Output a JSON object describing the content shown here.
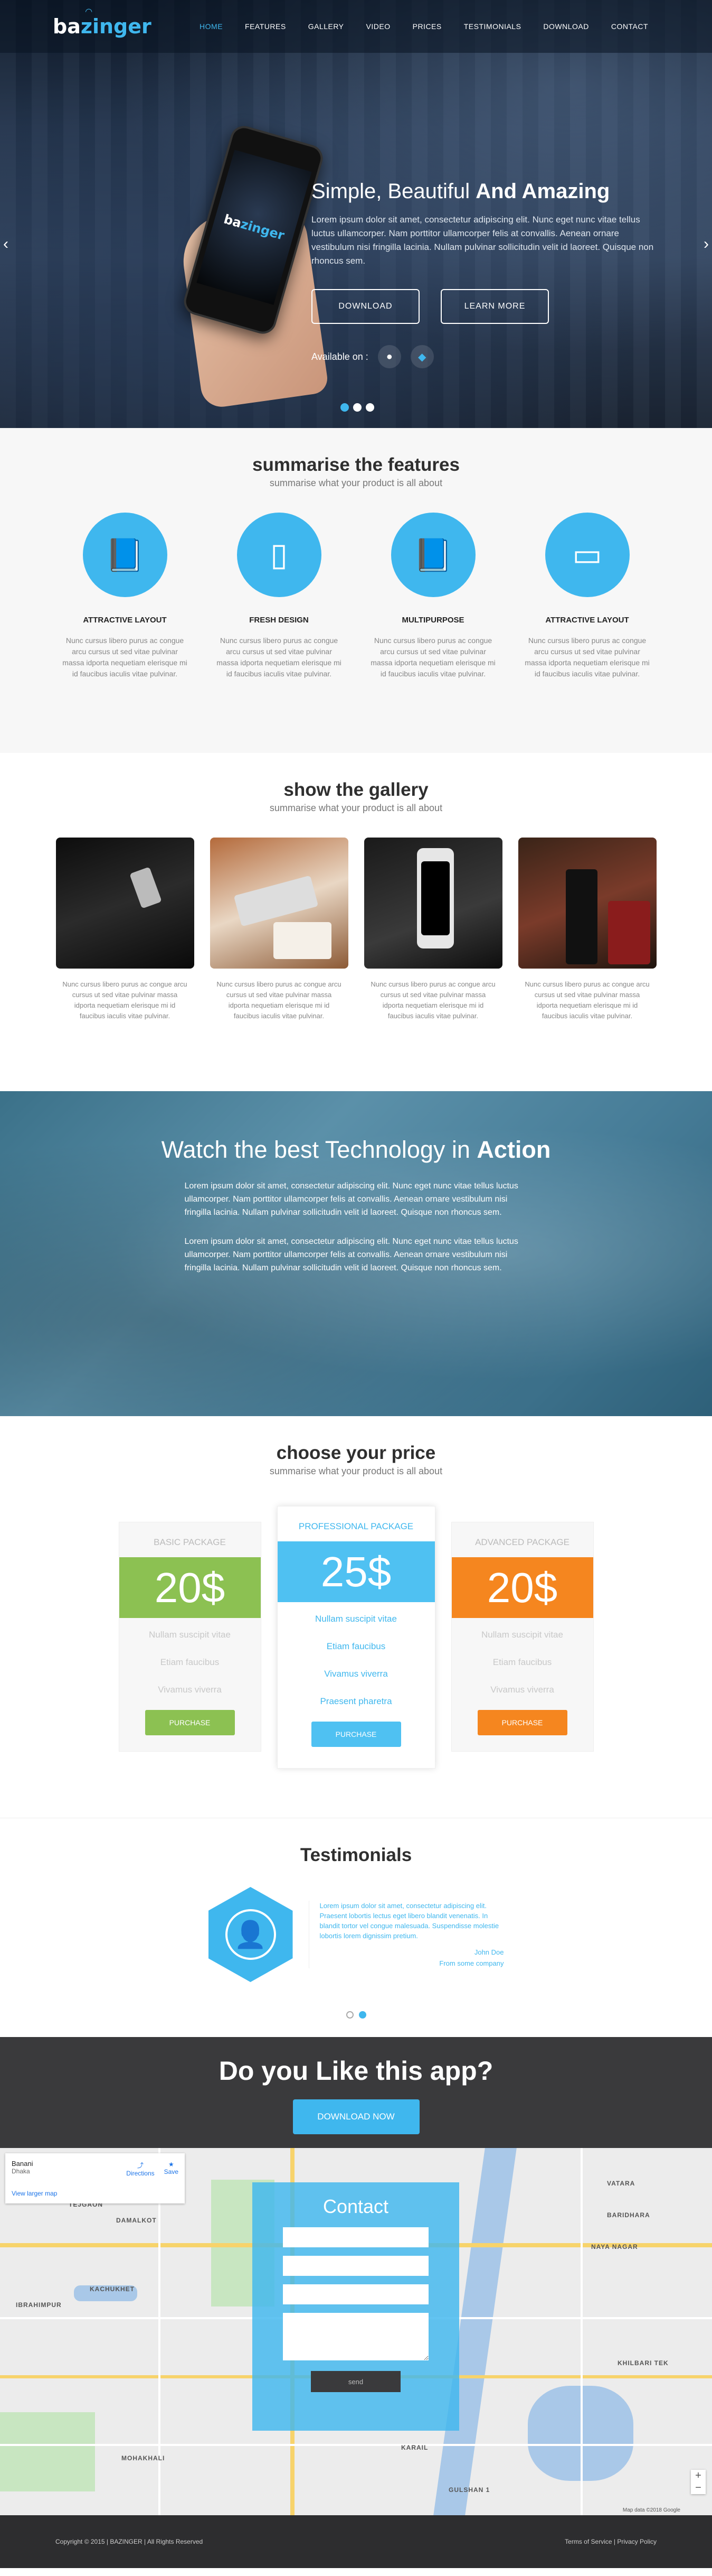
{
  "nav": {
    "logo_main": "ba",
    "logo_accent": "zinger",
    "items": [
      "HOME",
      "FEATURES",
      "GALLERY",
      "VIDEO",
      "PRICES",
      "TESTIMONIALS",
      "DOWNLOAD",
      "CONTACT"
    ]
  },
  "hero": {
    "title_light": "Simple, Beautiful ",
    "title_bold": "And Amazing",
    "description": "Lorem ipsum dolor sit amet, consectetur adipiscing elit. Nunc eget nunc vitae tellus luctus ullamcorper. Nam porttitor ullamcorper felis at convallis. Aenean ornare vestibulum nisi fringilla lacinia. Nullam pulvinar sollicitudin velit id laoreet. Quisque non rhoncus sem.",
    "btn_download": "DOWNLOAD",
    "btn_learn": "LEARN MORE",
    "available_on": "Available on :",
    "phone_logo_main": "ba",
    "phone_logo_accent": "zinger"
  },
  "features": {
    "title": "summarise the features",
    "subtitle": "summarise what your product is all about",
    "items": [
      {
        "title": "ATTRACTIVE LAYOUT",
        "text": "Nunc cursus libero purus ac congue arcu cursus ut sed vitae pulvinar massa idporta nequetiam elerisque mi id faucibus iaculis vitae pulvinar.",
        "icon": "book-icon"
      },
      {
        "title": "FRESH DESIGN",
        "text": "Nunc cursus libero purus ac congue arcu cursus ut sed vitae pulvinar massa idporta nequetiam elerisque mi id faucibus iaculis vitae pulvinar.",
        "icon": "mobile-icon"
      },
      {
        "title": "MULTIPURPOSE",
        "text": "Nunc cursus libero purus ac congue arcu cursus ut sed vitae pulvinar massa idporta nequetiam elerisque mi id faucibus iaculis vitae pulvinar.",
        "icon": "book-icon"
      },
      {
        "title": "ATTRACTIVE LAYOUT",
        "text": "Nunc cursus libero purus ac congue arcu cursus ut sed vitae pulvinar massa idporta nequetiam elerisque mi id faucibus iaculis vitae pulvinar.",
        "icon": "desktop-icon"
      }
    ]
  },
  "gallery": {
    "title": "show the gallery",
    "subtitle": "summarise what your product is all about",
    "items": [
      {
        "text": "Nunc cursus libero purus ac congue arcu cursus ut sed vitae pulvinar massa idporta nequetiam elerisque mi id faucibus iaculis vitae pulvinar."
      },
      {
        "text": "Nunc cursus libero purus ac congue arcu cursus ut sed vitae pulvinar massa idporta nequetiam elerisque mi id faucibus iaculis vitae pulvinar."
      },
      {
        "text": "Nunc cursus libero purus ac congue arcu cursus ut sed vitae pulvinar massa idporta nequetiam elerisque mi id faucibus iaculis vitae pulvinar."
      },
      {
        "text": "Nunc cursus libero purus ac congue arcu cursus ut sed vitae pulvinar massa idporta nequetiam elerisque mi id faucibus iaculis vitae pulvinar."
      }
    ]
  },
  "action": {
    "title_light": "Watch the best Technology in ",
    "title_bold": "Action",
    "p1": "Lorem ipsum dolor sit amet, consectetur adipiscing elit. Nunc eget nunc vitae tellus luctus ullamcorper. Nam porttitor ullamcorper felis at convallis. Aenean ornare vestibulum nisi fringilla lacinia. Nullam pulvinar sollicitudin velit id laoreet. Quisque non rhoncus sem.",
    "p2": "Lorem ipsum dolor sit amet, consectetur adipiscing elit. Nunc eget nunc vitae tellus luctus ullamcorper. Nam porttitor ullamcorper felis at convallis. Aenean ornare vestibulum nisi fringilla lacinia. Nullam pulvinar sollicitudin velit id laoreet. Quisque non rhoncus sem."
  },
  "pricing": {
    "title": "choose your price",
    "subtitle": "summarise what your product is all about",
    "plans": [
      {
        "name": "BASIC PACKAGE",
        "price": "20$",
        "features": [
          "Nullam suscipit vitae",
          "Etiam faucibus",
          "Vivamus viverra"
        ],
        "button": "PURCHASE"
      },
      {
        "name": "PROFESSIONAL PACKAGE",
        "price": "25$",
        "features": [
          "Nullam suscipit vitae",
          "Etiam faucibus",
          "Vivamus viverra",
          "Praesent pharetra"
        ],
        "button": "PURCHASE"
      },
      {
        "name": "ADVANCED PACKAGE",
        "price": "20$",
        "features": [
          "Nullam suscipit vitae",
          "Etiam faucibus",
          "Vivamus viverra"
        ],
        "button": "PURCHASE"
      }
    ]
  },
  "testimonials": {
    "title": "Testimonials",
    "quote": "Lorem ipsum dolor sit amet, consectetur adipiscing elit. Praesent lobortis lectus eget libero blandit venenatis. In blandit tortor vel congue malesuada. Suspendisse molestie lobortis lorem dignissim pretium.",
    "author": "John Doe",
    "company": "From some company"
  },
  "cta": {
    "title": "Do you Like this app?",
    "button": "DOWNLOAD NOW"
  },
  "map": {
    "place": "Banani",
    "city": "Dhaka",
    "directions": "Directions",
    "save": "Save",
    "view_larger": "View larger map",
    "labels": [
      "TEJGAON",
      "DAMALKOT",
      "NAYA NAGAR",
      "VATARA",
      "BARIDHARA",
      "KACHUKHET",
      "IBRAHIMPUR",
      "MOHAKHALI",
      "KARAIL",
      "KHILBARI TEK",
      "GULSHAN 1"
    ],
    "copyright": "Map data ©2018 Google"
  },
  "contact": {
    "title": "Contact",
    "send": "send"
  },
  "footer": {
    "copyright": "Copyright © 2015 | BAZINGER | All Rights Reserved",
    "links": "Terms of Service | Privacy Policy"
  },
  "colors": {
    "accent": "#3fb7ee",
    "green": "#8cc152",
    "orange": "#f5861f",
    "dark": "#3a3a3c"
  }
}
